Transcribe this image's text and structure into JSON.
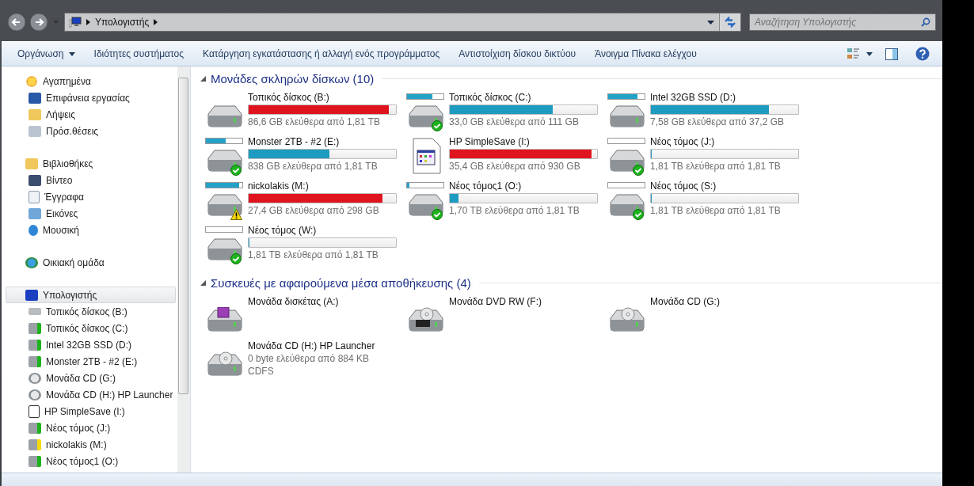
{
  "address_bar": {
    "crumbs": [
      "Υπολογιστής"
    ]
  },
  "search": {
    "placeholder": "Αναζήτηση Υπολογιστής"
  },
  "toolbar": {
    "items": [
      {
        "label": "Οργάνωση",
        "dropdown": true
      },
      {
        "label": "Ιδιότητες συστήματος",
        "dropdown": false
      },
      {
        "label": "Κατάργηση εγκατάστασης ή αλλαγή ενός προγράμματος",
        "dropdown": false
      },
      {
        "label": "Αντιστοίχιση δίσκου δικτύου",
        "dropdown": false
      },
      {
        "label": "Άνοιγμα Πίνακα ελέγχου",
        "dropdown": false
      }
    ]
  },
  "sidebar": {
    "groups": [
      {
        "label": "Αγαπημένα",
        "kind": "star",
        "selected": false,
        "children": [
          {
            "label": "Επιφάνεια εργασίας",
            "kind": "desktop"
          },
          {
            "label": "Λήψεις",
            "kind": "downloads"
          },
          {
            "label": "Πρόσ.θέσεις",
            "kind": "places"
          }
        ]
      },
      {
        "label": "Βιβλιοθήκες",
        "kind": "library",
        "selected": false,
        "children": [
          {
            "label": "Βίντεο",
            "kind": "video"
          },
          {
            "label": "Έγγραφα",
            "kind": "document"
          },
          {
            "label": "Εικόνες",
            "kind": "picture"
          },
          {
            "label": "Μουσική",
            "kind": "music"
          }
        ]
      },
      {
        "label": "Οικιακή ομάδα",
        "kind": "homegroup",
        "selected": false
      },
      {
        "label": "Υπολογιστής",
        "kind": "computer",
        "selected": true,
        "children": [
          {
            "label": "Τοπικός δίσκος (B:)",
            "kind": "drive"
          },
          {
            "label": "Τοπικός δίσκος (C:)",
            "kind": "drive-ok"
          },
          {
            "label": "Intel 32GB SSD (D:)",
            "kind": "drive-ok"
          },
          {
            "label": "Monster 2TB - #2 (E:)",
            "kind": "drive-ok"
          },
          {
            "label": "Μονάδα CD (G:)",
            "kind": "cd"
          },
          {
            "label": "Μονάδα CD (H:) HP Launcher",
            "kind": "cd"
          },
          {
            "label": "HP SimpleSave (I:)",
            "kind": "app"
          },
          {
            "label": "Νέος τόμος (J:)",
            "kind": "drive-ok"
          },
          {
            "label": "nickolakis (M:)",
            "kind": "drive-warn"
          },
          {
            "label": "Νέος τόμος1 (O:)",
            "kind": "drive-ok"
          }
        ]
      }
    ]
  },
  "sections": [
    {
      "title": "Μονάδες σκληρών δίσκων (10)",
      "expanded": true,
      "items": [
        {
          "kind": "hdd",
          "name": "Τοπικός δίσκος (B:)",
          "level": 0.95,
          "color": "#e0141e",
          "free": "86,6 GB ελεύθερα από 1,81 TB",
          "healthy": false,
          "warning": false,
          "indexed": false
        },
        {
          "kind": "hdd",
          "name": "Τοπικός δίσκος (C:)",
          "level": 0.7,
          "color": "#1e9bc0",
          "free": "33,0 GB ελεύθερα από 111 GB",
          "healthy": true,
          "warning": false,
          "indexed": true
        },
        {
          "kind": "hdd",
          "name": "Intel 32GB SSD (D:)",
          "level": 0.8,
          "color": "#1e9bc0",
          "free": "7,58 GB ελεύθερα από 37,2 GB",
          "healthy": false,
          "warning": false,
          "indexed": true
        },
        {
          "kind": "hdd",
          "name": "Monster 2TB - #2 (E:)",
          "level": 0.55,
          "color": "#1e9bc0",
          "free": "838 GB ελεύθερα από 1,81 TB",
          "healthy": true,
          "warning": false,
          "indexed": true
        },
        {
          "kind": "app",
          "name": "HP SimpleSave (I:)",
          "level": 0.96,
          "color": "#e0141e",
          "free": "35,4 GB ελεύθερα από 930 GB",
          "healthy": false,
          "warning": false,
          "indexed": false
        },
        {
          "kind": "hdd",
          "name": "Νέος τόμος (J:)",
          "level": 0.0,
          "color": "#1e9bc0",
          "free": "1,81 TB ελεύθερα από 1,81 TB",
          "healthy": true,
          "warning": false,
          "indexed": true
        },
        {
          "kind": "hdd",
          "name": "nickolakis (M:)",
          "level": 0.91,
          "color": "#e0141e",
          "free": "27,4 GB ελεύθερα από 298 GB",
          "healthy": false,
          "warning": true,
          "indexed": true
        },
        {
          "kind": "hdd",
          "name": "Νέος τόμος1 (O:)",
          "level": 0.06,
          "color": "#1e9bc0",
          "free": "1,70 TB ελεύθερα από 1,81 TB",
          "healthy": true,
          "warning": false,
          "indexed": true
        },
        {
          "kind": "hdd",
          "name": "Νέος τόμος (S:)",
          "level": 0.0,
          "color": "#1e9bc0",
          "free": "1,81 TB ελεύθερα από 1,81 TB",
          "healthy": true,
          "warning": false,
          "indexed": true
        },
        {
          "kind": "hdd",
          "name": "Νέος τόμος (W:)",
          "level": 0.0,
          "color": "#1e9bc0",
          "free": "1,81 TB ελεύθερα από 1,81 TB",
          "healthy": true,
          "warning": false,
          "indexed": true
        }
      ]
    },
    {
      "title": "Συσκευές με αφαιρούμενα μέσα αποθήκευσης (4)",
      "expanded": true,
      "items": [
        {
          "kind": "floppy",
          "name": "Μονάδα δισκέτας (A:)"
        },
        {
          "kind": "dvd",
          "name": "Μονάδα DVD RW (F:)"
        },
        {
          "kind": "cd",
          "name": "Μονάδα CD (G:)"
        },
        {
          "kind": "cd",
          "name": "Μονάδα CD (H:) HP Launcher",
          "lines": [
            "0 byte ελεύθερα από 884 KB",
            "CDFS"
          ]
        }
      ]
    }
  ]
}
